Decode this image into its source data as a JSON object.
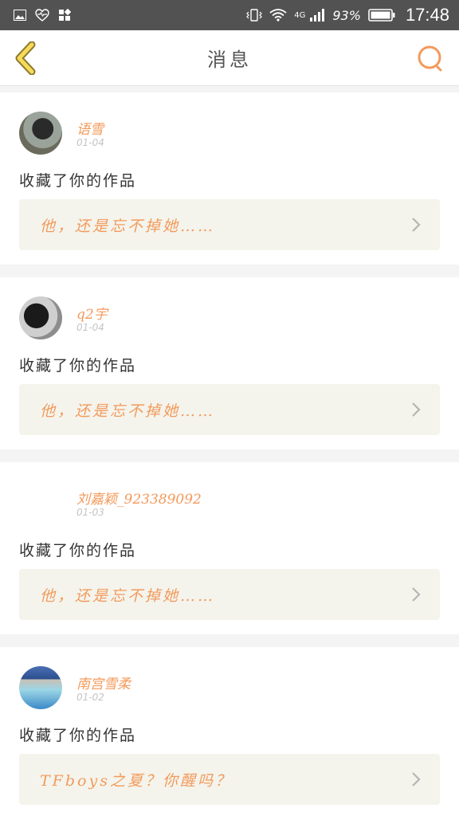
{
  "status_bar": {
    "network": "4G",
    "battery_percent": "93%",
    "time": "17:48"
  },
  "nav": {
    "title": "消息",
    "accent_color": "#f39a5c"
  },
  "messages": [
    {
      "username": "语雪",
      "date": "01-04",
      "action": "收藏了你的作品",
      "work_title": "他，还是忘不掉她……"
    },
    {
      "username": "q2宇",
      "date": "01-04",
      "action": "收藏了你的作品",
      "work_title": "他，还是忘不掉她……"
    },
    {
      "username": "刘嘉颖_923389092",
      "date": "01-03",
      "action": "收藏了你的作品",
      "work_title": "他，还是忘不掉她……"
    },
    {
      "username": "南宫雪柔",
      "date": "01-02",
      "action": "收藏了你的作品",
      "work_title": "TFboys之夏？你醒吗？"
    }
  ]
}
